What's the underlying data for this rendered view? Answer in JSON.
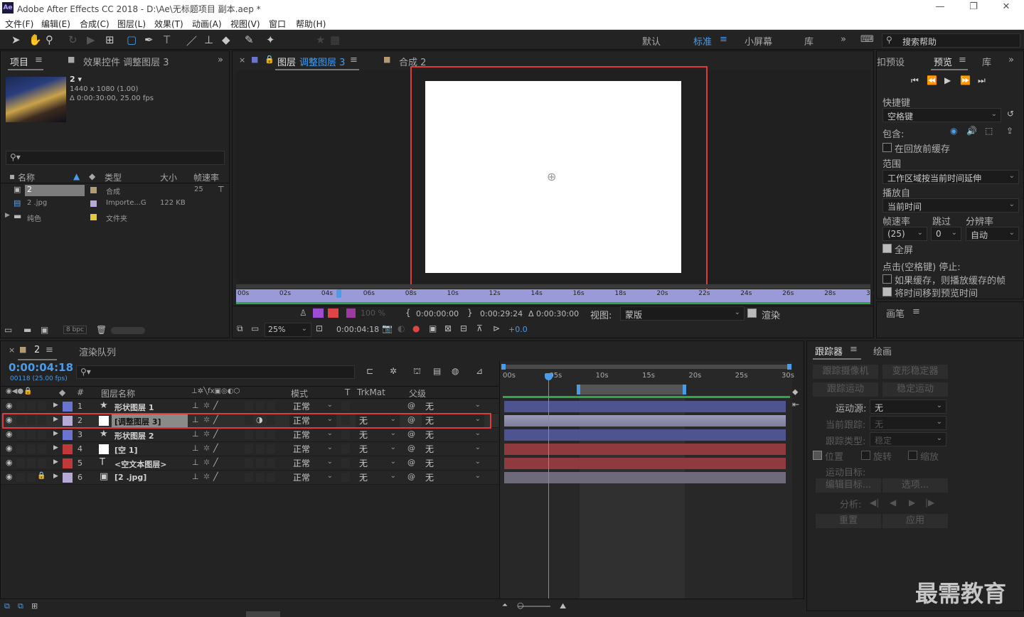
{
  "app": {
    "title": "Adobe After Effects CC 2018 - D:\\Ae\\无标题项目 副本.aep *",
    "logo": "Ae",
    "controls": [
      "—",
      "❐",
      "✕"
    ]
  },
  "menu": [
    "文件(F)",
    "编辑(E)",
    "合成(C)",
    "图层(L)",
    "效果(T)",
    "动画(A)",
    "视图(V)",
    "窗口",
    "帮助(H)"
  ],
  "workspaces": {
    "default": "默认",
    "standard": "标准",
    "small": "小屏幕",
    "library": "库",
    "more": "»",
    "search_placeholder": "搜索帮助"
  },
  "project": {
    "tab_label": "项目",
    "effects_tab": "效果控件 调整图层 3",
    "item_name": "2 ▾",
    "item_size": "1440 x 1080 (1.00)",
    "item_dur": "Δ 0:00:30:00, 25.00 fps",
    "search_placeholder": "",
    "columns": [
      "名称",
      "类型",
      "大小",
      "帧速率"
    ],
    "items": [
      {
        "name": "2",
        "type": "合成",
        "size": "",
        "fps": "25",
        "color": "#b59a72"
      },
      {
        "name": "2 .jpg",
        "type": "Importe...G",
        "size": "122 KB",
        "fps": "",
        "color": "#b6a9d6"
      },
      {
        "name": "纯色",
        "type": "文件夹",
        "size": "",
        "fps": "",
        "color": "#e4c73a"
      }
    ],
    "bpc": "8 bpc"
  },
  "comp": {
    "tab_layer": "图层",
    "tab_layer_name": "调整图层 3",
    "tab_comp": "合成 2",
    "ruler": [
      "00s",
      "02s",
      "04s",
      "06s",
      "08s",
      "10s",
      "12s",
      "14s",
      "16s",
      "18s",
      "20s",
      "22s",
      "24s",
      "26s",
      "28s",
      "30s"
    ],
    "zoom_pct": "100 %",
    "in_time": "0:00:00:00",
    "out_time": "0:00:29:24",
    "dur_time": "Δ 0:00:30:00",
    "view_label": "视图:",
    "view_value": "蒙版",
    "render_label": "渲染",
    "zoom_select": "25%",
    "current_time": "0:00:04:18",
    "exposure": "+0.0"
  },
  "preview": {
    "tabs": [
      "扣预设",
      "预览",
      "库"
    ],
    "shortcut_label": "快捷键",
    "shortcut_value": "空格键",
    "include_label": "包含:",
    "cache_before": "在回放前缓存",
    "range_label": "范围",
    "range_value": "工作区域按当前时间延伸",
    "play_from_label": "播放自",
    "play_from_value": "当前时间",
    "fps_label": "帧速率",
    "skip_label": "跳过",
    "res_label": "分辨率",
    "fps_value": "(25)",
    "skip_value": "0",
    "res_value": "自动",
    "fullscreen": "全屏",
    "stop_label": "点击(空格键) 停止:",
    "opt1": "如果缓存，则播放缓存的帧",
    "opt2": "将时间移到预览时间",
    "paint_tab": "画笔"
  },
  "timeline": {
    "comp_tab": "2",
    "render_tab": "渲染队列",
    "timecode": "0:00:04:18",
    "frames": "00118 (25.00 fps)",
    "col_name": "图层名称",
    "col_mode": "模式",
    "col_t": "T",
    "col_trkmat": "TrkMat",
    "col_parent": "父级",
    "ruler": [
      "00s",
      "05s",
      "10s",
      "15s",
      "20s",
      "25s",
      "30s"
    ],
    "layers": [
      {
        "num": "1",
        "name": "形状图层 1",
        "icon": "★",
        "mode": "正常",
        "trkmat": "",
        "parent": "无",
        "color": "#6b74d0",
        "bar": "#4d5490"
      },
      {
        "num": "2",
        "name": "[调整图层 3]",
        "icon": "□",
        "mode": "正常",
        "trkmat": "无",
        "parent": "无",
        "color": "#b6a9d6",
        "bar": "#8a89a6"
      },
      {
        "num": "3",
        "name": "形状图层 2",
        "icon": "★",
        "mode": "正常",
        "trkmat": "无",
        "parent": "无",
        "color": "#6b74d0",
        "bar": "#4d5490"
      },
      {
        "num": "4",
        "name": "[空 1]",
        "icon": "□",
        "mode": "正常",
        "trkmat": "无",
        "parent": "无",
        "color": "#c03a3a",
        "bar": "#8e3a3e"
      },
      {
        "num": "5",
        "name": "<空文本图层>",
        "icon": "T",
        "mode": "正常",
        "trkmat": "无",
        "parent": "无",
        "color": "#c03a3a",
        "bar": "#8e3a3e"
      },
      {
        "num": "6",
        "name": "[2 .jpg]",
        "icon": "▣",
        "mode": "正常",
        "trkmat": "无",
        "parent": "无",
        "color": "#b6a9d6",
        "bar": "#6e6a7c"
      }
    ]
  },
  "tracker": {
    "tab": "跟踪器",
    "paint_tab": "绘画",
    "track_camera": "跟踪摄像机",
    "warp": "变形稳定器",
    "track_motion": "跟踪运动",
    "stabilize": "稳定运动",
    "source_label": "运动源:",
    "source_value": "无",
    "current_label": "当前跟踪:",
    "current_value": "无",
    "type_label": "跟踪类型:",
    "type_value": "稳定",
    "pos": "位置",
    "rot": "旋转",
    "scale": "缩放",
    "target_label": "运动目标:",
    "edit_target": "编辑目标...",
    "options": "选项...",
    "analyze_label": "分析:",
    "reset": "重置",
    "apply": "应用"
  },
  "watermark": "最需教育"
}
